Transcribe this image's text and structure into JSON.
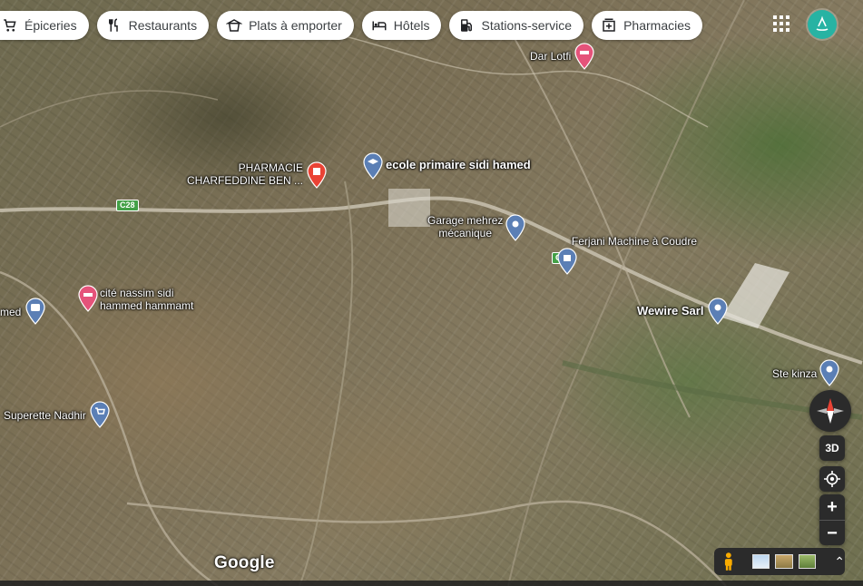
{
  "chips": [
    {
      "label": "Épiceries",
      "icon": "cart-icon"
    },
    {
      "label": "Restaurants",
      "icon": "fork-knife-icon"
    },
    {
      "label": "Plats à emporter",
      "icon": "takeout-icon"
    },
    {
      "label": "Hôtels",
      "icon": "bed-icon"
    },
    {
      "label": "Stations-service",
      "icon": "fuel-icon"
    },
    {
      "label": "Pharmacies",
      "icon": "pharmacy-icon"
    }
  ],
  "places": {
    "dar_lotfi": "Dar Lotfi",
    "pharmacie_line1": "PHARMACIE",
    "pharmacie_line2": "CHARFEDDINE BEN ...",
    "ecole": "ecole primaire sidi hamed",
    "garage_line1": "Garage mehrez",
    "garage_line2": "mécanique",
    "ferjani": "Ferjani Machine à Coudre",
    "wewire": "Wewire Sarl",
    "ste_kinza": "Ste kinza",
    "cite_line1": "cité nassim sidi",
    "cite_line2": "hammed hammamt",
    "hamed_partial": "med",
    "superette": "Superette Nadhir"
  },
  "route_labels": [
    "C28",
    "C28"
  ],
  "controls": {
    "three_d": "3D",
    "zoom_in": "+",
    "zoom_out": "−",
    "expand": "⌃"
  },
  "brand": "Google",
  "colors": {
    "chip_bg": "#ffffff",
    "avatar": "#27b3a3",
    "pin_red": "#ea4335",
    "pin_blue": "#5b7fb5",
    "pin_pink": "#e5537a",
    "control_bg": "#2b2b2b"
  }
}
